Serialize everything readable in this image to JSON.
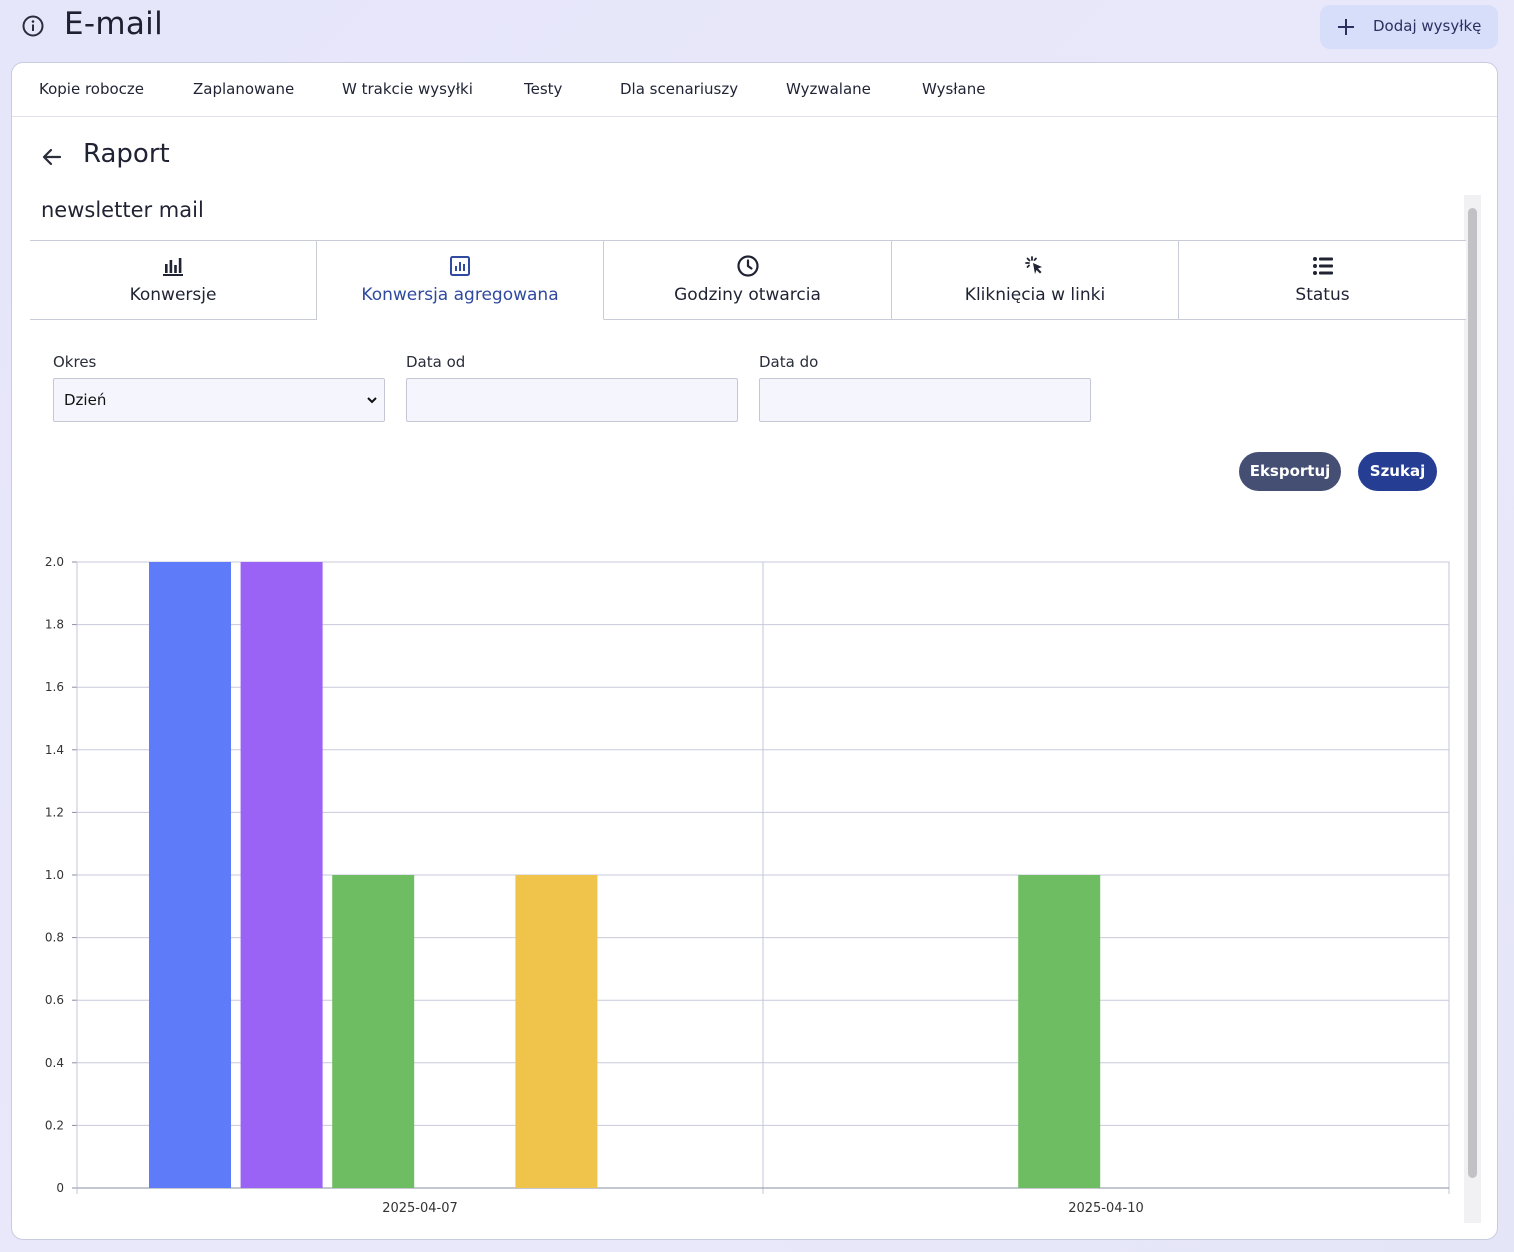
{
  "app": {
    "title": "E-mail",
    "add_button": "Dodaj wysyłkę"
  },
  "nav_tabs": [
    "Kopie robocze",
    "Zaplanowane",
    "W trakcie wysyłki",
    "Testy",
    "Dla scenariuszy",
    "Wyzwalane",
    "Wysłane"
  ],
  "page": {
    "title": "Raport",
    "subtitle": "newsletter mail"
  },
  "report_tabs": [
    {
      "label": "Konwersje",
      "icon": "bar-chart-icon",
      "active": false
    },
    {
      "label": "Konwersja agregowana",
      "icon": "chart-box-icon",
      "active": true
    },
    {
      "label": "Godziny otwarcia",
      "icon": "clock-icon",
      "active": false
    },
    {
      "label": "Kliknięcia w linki",
      "icon": "cursor-click-icon",
      "active": false
    },
    {
      "label": "Status",
      "icon": "list-icon",
      "active": false
    }
  ],
  "filters": {
    "period_label": "Okres",
    "period_value": "Dzień",
    "date_from_label": "Data od",
    "date_from_value": "",
    "date_to_label": "Data do",
    "date_to_value": ""
  },
  "buttons": {
    "export": "Eksportuj",
    "search": "Szukaj"
  },
  "colors": {
    "accent": "#2f4a9e",
    "blue": "#5e7bfa",
    "purple": "#9b62f6",
    "green": "#6fbd63",
    "yellow": "#f0c34b"
  },
  "chart_data": {
    "type": "bar",
    "categories": [
      "2025-04-07",
      "2025-04-10"
    ],
    "series": [
      {
        "values": [
          2,
          0
        ],
        "color": "#5e7bfa"
      },
      {
        "values": [
          2,
          0
        ],
        "color": "#9b62f6"
      },
      {
        "values": [
          1,
          1
        ],
        "color": "#6fbd63"
      },
      {
        "values": [
          0,
          0
        ],
        "color": "#e05555"
      },
      {
        "values": [
          1,
          0
        ],
        "color": "#f0c34b"
      }
    ],
    "ylim": [
      0,
      2
    ],
    "yticks": [
      "0",
      "0.2",
      "0.4",
      "0.6",
      "0.8",
      "1.0",
      "1.2",
      "1.4",
      "1.6",
      "1.8",
      "2.0"
    ],
    "grid": true
  }
}
